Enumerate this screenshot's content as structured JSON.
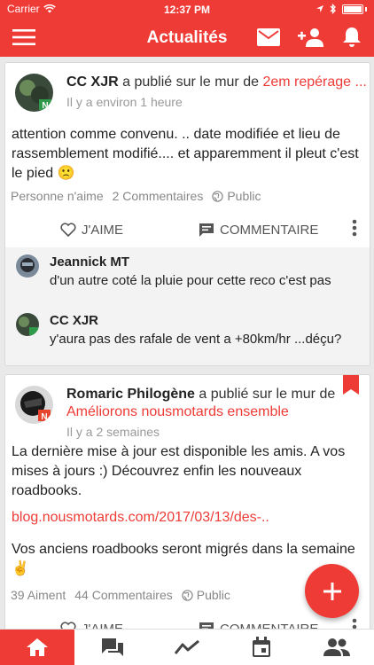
{
  "status": {
    "carrier": "Carrier",
    "time": "12:37 PM"
  },
  "header": {
    "title": "Actualités"
  },
  "posts": [
    {
      "author": "CC XJR",
      "published_text": "a publié sur le mur de",
      "wall": "2em repérage ...",
      "time": "Il y a environ 1 heure",
      "body": "attention comme convenu. .. date modifiée  et lieu de rassemblement  modifié.... et apparemment  il pleut c'est le pied 🙁",
      "likes": "Personne n'aime",
      "comments_count": "2 Commentaires",
      "visibility": "Public",
      "like_label": "J'AIME",
      "comment_label": "COMMENTAIRE",
      "comments": [
        {
          "author": "Jeannick MT",
          "text": "d'un autre coté la pluie pour cette reco c'est pas"
        },
        {
          "author": "CC XJR",
          "text": "y'aura pas des rafale de vent a +80km/hr ...déçu?"
        }
      ]
    },
    {
      "author": "Romaric Philogène",
      "published_text": "a publié sur le mur de",
      "wall": "Améliorons nousmotards ensemble",
      "time": "Il y a 2 semaines",
      "body": "La dernière mise à jour est disponible les amis. A vos mises à jours :) Découvrez enfin les nouveaux roadbooks.",
      "link": "blog.nousmotards.com/2017/03/13/des-..",
      "body2": "Vos anciens roadbooks seront migrés dans la semaine ✌️",
      "likes": "39 Aiment",
      "comments_count": "44 Commentaires",
      "visibility": "Public",
      "like_label": "J'AIME",
      "comment_label": "COMMENTAIRE"
    }
  ],
  "colors": {
    "accent": "#ee3b36"
  },
  "tabs": [
    "home-icon",
    "messages-icon",
    "activity-icon",
    "calendar-icon",
    "people-icon"
  ]
}
